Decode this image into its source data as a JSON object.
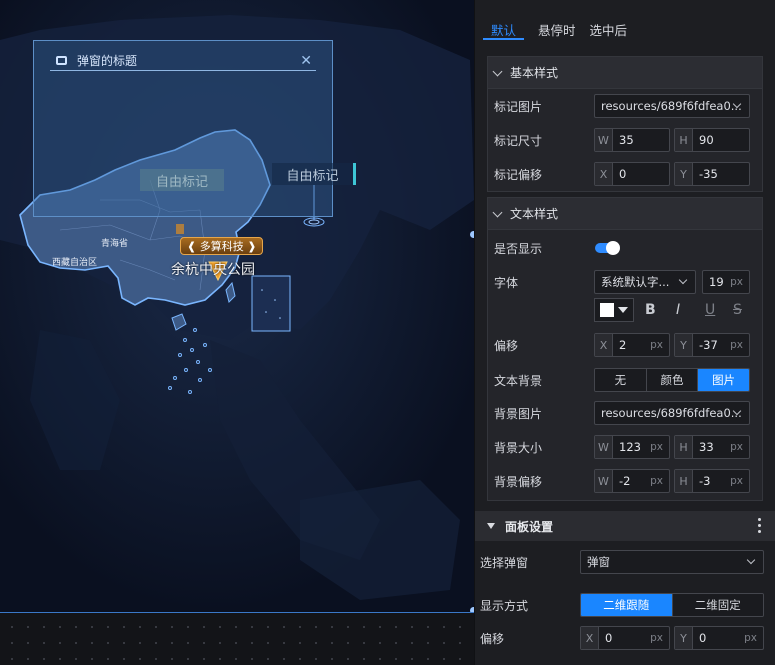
{
  "map": {
    "popup_title": "弹窗的标题",
    "close_glyph": "✕",
    "free_tag_1": "自由标记",
    "free_tag_2": "自由标记",
    "marker_label": "❰ 多算科技 ❱",
    "poi_label": "余杭中央公园",
    "place_qinghai": "青海省",
    "place_tibet": "西藏自治区",
    "colors": {
      "boundary": "#7ab6ff",
      "land": "#3d5a86",
      "ocean": "#0c1326"
    }
  },
  "panel": {
    "tabs": [
      "默认",
      "悬停时",
      "选中后"
    ],
    "active_tab": "默认",
    "basic": {
      "title": "基本样式",
      "marker_image_label": "标记图片",
      "marker_image_value": "resources/689f6fdfea0...",
      "marker_size_label": "标记尺寸",
      "size_w_prefix": "W",
      "size_w": "35",
      "size_h_prefix": "H",
      "size_h": "90",
      "marker_offset_label": "标记偏移",
      "offset_x_prefix": "X",
      "offset_x": "0",
      "offset_y_prefix": "Y",
      "offset_y": "-35"
    },
    "text": {
      "title": "文本样式",
      "show_label": "是否显示",
      "show": true,
      "font_label": "字体",
      "font_value": "系统默认字...",
      "font_size": "19",
      "unit": "px",
      "text_color": "#ffffff",
      "bold_glyph": "B",
      "italic_glyph": "I",
      "underline_glyph": "U",
      "strike_glyph": "S",
      "offset_label": "偏移",
      "offset_x_prefix": "X",
      "offset_x": "2",
      "offset_y_prefix": "Y",
      "offset_y": "-37",
      "bg_label": "文本背景",
      "bg_options": [
        "无",
        "颜色",
        "图片"
      ],
      "bg_selected": "图片",
      "bg_image_label": "背景图片",
      "bg_image_value": "resources/689f6fdfea0...",
      "bg_size_label": "背景大小",
      "bg_w_prefix": "W",
      "bg_w": "123",
      "bg_h_prefix": "H",
      "bg_h": "33",
      "bg_offset_label": "背景偏移",
      "bg_off_w_prefix": "W",
      "bg_off_w": "-2",
      "bg_off_h_prefix": "H",
      "bg_off_h": "-3"
    },
    "panel_settings": {
      "title": "面板设置",
      "popup_select_label": "选择弹窗",
      "popup_select_value": "弹窗",
      "display_label": "显示方式",
      "display_options": [
        "二维跟随",
        "二维固定"
      ],
      "display_selected": "二维跟随",
      "offset_label": "偏移",
      "offset_x_prefix": "X",
      "offset_x": "0",
      "offset_y_prefix": "Y",
      "offset_y": "0",
      "unit": "px"
    },
    "accent_color": "#1a86ff"
  }
}
